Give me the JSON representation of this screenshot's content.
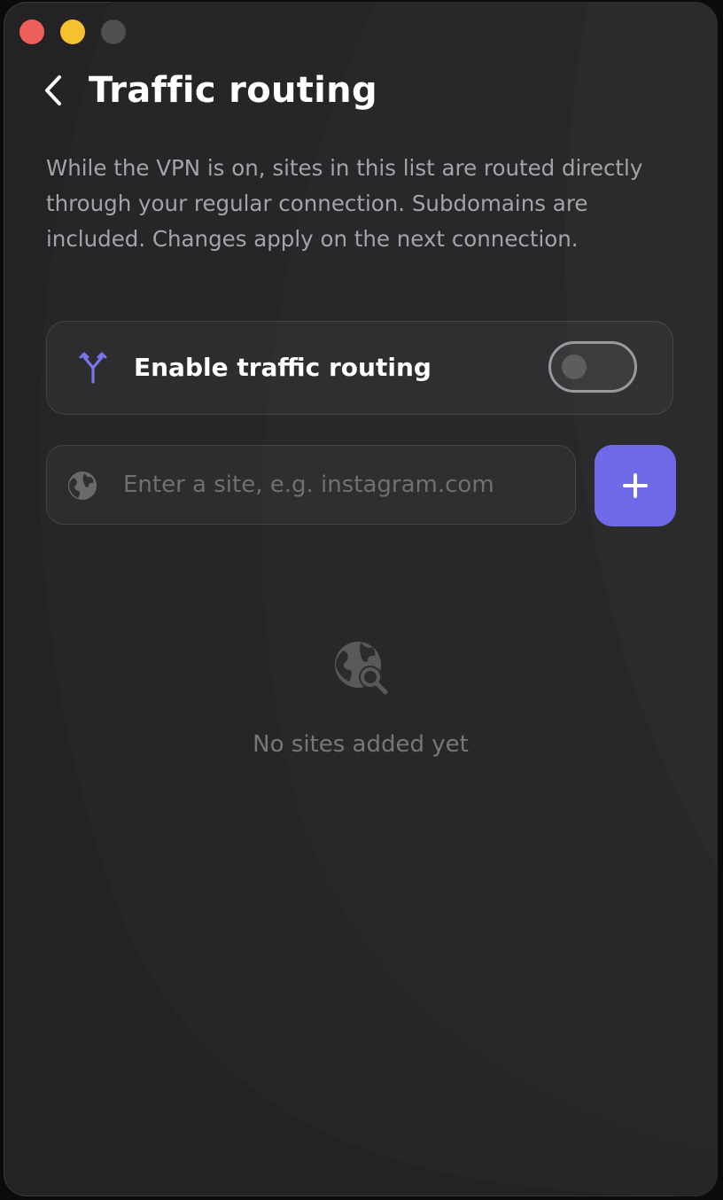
{
  "window": {
    "controls": {
      "close_color": "#ee5f5a",
      "minimize_color": "#f5c12e",
      "zoom_color": "#4e4e50"
    }
  },
  "header": {
    "back_icon": "chevron-left-icon",
    "title": "Traffic routing"
  },
  "description": "While the VPN is on, sites in this list are routed directly through your regular connection. Subdomains are included. Changes apply on the next connection.",
  "routing_toggle": {
    "icon": "route-split-icon",
    "label": "Enable traffic routing",
    "enabled": false
  },
  "site_input": {
    "icon": "globe-icon",
    "value": "",
    "placeholder": "Enter a site, e.g. instagram.com"
  },
  "add_button": {
    "icon": "plus-icon"
  },
  "empty_state": {
    "icon": "globe-search-icon",
    "text": "No sites added yet"
  },
  "colors": {
    "accent": "#6f6ae8",
    "background": "#232325"
  }
}
